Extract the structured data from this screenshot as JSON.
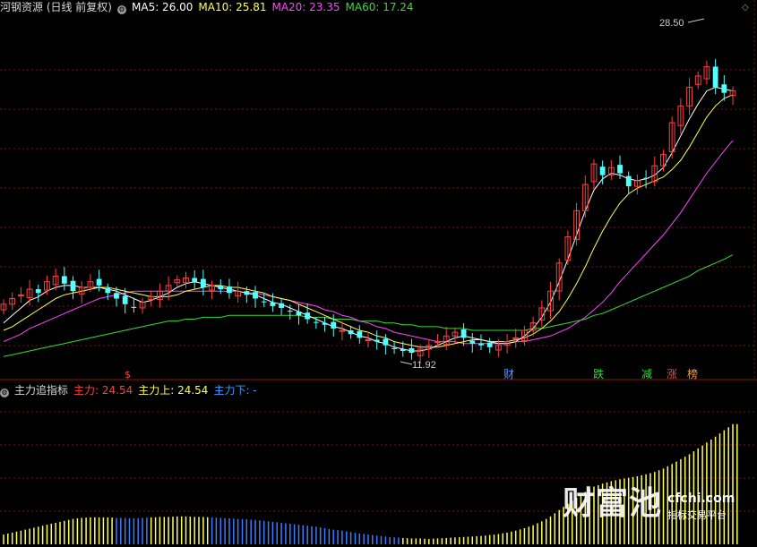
{
  "header": {
    "stock_title": "河钢资源 (日线 前复权)",
    "ma5_label": "MA5: 26.00",
    "ma10_label": "MA10: 25.81",
    "ma20_label": "MA20: 23.35",
    "ma60_label": "MA60: 17.24"
  },
  "indicator": {
    "title": "主力追指标",
    "main_label": "主力: 24.54",
    "upper_label": "主力上: 24.54",
    "lower_label": "主力下: -"
  },
  "annotations": {
    "high_price": "28.50",
    "low_price": "11.92",
    "markers": [
      "$",
      "财",
      "跌",
      "减",
      "涨",
      "榜"
    ]
  },
  "watermark": {
    "cn": "财富池",
    "en": "cfchi.com",
    "sub": "指标交易平台"
  },
  "colors": {
    "background": "#000000",
    "grid": "#7a1010",
    "up_candle": "#ff4040",
    "down_candle": "#54ffff",
    "ma5": "#ffffff",
    "ma10": "#ffff4d",
    "ma20": "#ff44ff",
    "ma60": "#33dd33",
    "bar_yellow": "#ffff55",
    "bar_blue": "#3a7dff"
  },
  "chart_data": {
    "type": "candlestick",
    "price_range": [
      11,
      30
    ],
    "high": 28.5,
    "low": 11.92,
    "closes": [
      14.6,
      14.9,
      15.1,
      15.4,
      15.2,
      15.8,
      16.1,
      15.7,
      15.3,
      15.5,
      15.8,
      15.6,
      15.2,
      14.9,
      14.6,
      14.4,
      14.7,
      15.0,
      15.3,
      15.6,
      15.9,
      16.0,
      15.8,
      15.5,
      15.6,
      15.4,
      15.2,
      15.3,
      15.1,
      14.9,
      14.7,
      14.5,
      14.4,
      14.2,
      14.0,
      13.8,
      13.6,
      13.5,
      13.3,
      13.2,
      13.0,
      12.8,
      12.7,
      12.6,
      12.4,
      12.2,
      12.1,
      12.0,
      12.2,
      12.4,
      12.6,
      12.9,
      13.1,
      12.8,
      12.5,
      12.4,
      12.3,
      12.4,
      12.6,
      12.8,
      13.2,
      13.6,
      14.4,
      15.3,
      16.8,
      18.2,
      19.6,
      21.0,
      22.1,
      21.5,
      21.9,
      21.6,
      20.9,
      21.2,
      21.3,
      22.0,
      22.6,
      24.3,
      25.2,
      26.2,
      26.8,
      27.3,
      26.2,
      25.9,
      26.0
    ],
    "ma5": [
      13.6,
      14.0,
      14.4,
      14.8,
      15.0,
      15.3,
      15.5,
      15.6,
      15.6,
      15.5,
      15.5,
      15.5,
      15.4,
      15.3,
      15.1,
      14.9,
      14.7,
      14.8,
      15.0,
      15.2,
      15.5,
      15.7,
      15.8,
      15.7,
      15.6,
      15.5,
      15.4,
      15.3,
      15.2,
      15.1,
      14.9,
      14.7,
      14.6,
      14.4,
      14.2,
      14.0,
      13.8,
      13.6,
      13.4,
      13.3,
      13.1,
      12.9,
      12.8,
      12.6,
      12.5,
      12.3,
      12.2,
      12.1,
      12.1,
      12.2,
      12.4,
      12.6,
      12.8,
      12.9,
      12.8,
      12.7,
      12.6,
      12.5,
      12.5,
      12.6,
      12.9,
      13.3,
      13.9,
      14.7,
      15.8,
      17.0,
      18.3,
      19.6,
      20.7,
      21.3,
      21.6,
      21.5,
      21.3,
      21.2,
      21.3,
      21.5,
      21.9,
      22.7,
      23.6,
      24.5,
      25.3,
      26.0,
      26.2,
      26.1,
      26.0
    ],
    "ma10": [
      13.2,
      13.4,
      13.7,
      14.0,
      14.3,
      14.6,
      14.9,
      15.1,
      15.2,
      15.3,
      15.4,
      15.5,
      15.5,
      15.4,
      15.3,
      15.2,
      15.1,
      15.0,
      15.0,
      15.0,
      15.1,
      15.3,
      15.4,
      15.5,
      15.6,
      15.6,
      15.5,
      15.5,
      15.4,
      15.3,
      15.2,
      15.0,
      14.9,
      14.8,
      14.6,
      14.4,
      14.2,
      14.0,
      13.8,
      13.6,
      13.4,
      13.2,
      13.1,
      12.9,
      12.8,
      12.6,
      12.5,
      12.4,
      12.3,
      12.3,
      12.3,
      12.4,
      12.5,
      12.6,
      12.7,
      12.7,
      12.6,
      12.6,
      12.6,
      12.7,
      12.8,
      13.0,
      13.3,
      13.7,
      14.2,
      14.9,
      15.7,
      16.6,
      17.6,
      18.5,
      19.3,
      20.0,
      20.5,
      20.8,
      21.0,
      21.2,
      21.4,
      21.8,
      22.3,
      23.0,
      23.8,
      24.6,
      25.2,
      25.6,
      25.8
    ],
    "ma20": [
      12.6,
      12.8,
      13.0,
      13.3,
      13.5,
      13.7,
      13.9,
      14.1,
      14.3,
      14.5,
      14.7,
      14.9,
      15.0,
      15.1,
      15.2,
      15.3,
      15.3,
      15.3,
      15.3,
      15.3,
      15.3,
      15.3,
      15.3,
      15.3,
      15.3,
      15.3,
      15.3,
      15.3,
      15.2,
      15.2,
      15.1,
      15.0,
      14.9,
      14.8,
      14.7,
      14.6,
      14.5,
      14.3,
      14.2,
      14.0,
      13.9,
      13.7,
      13.6,
      13.4,
      13.3,
      13.1,
      13.0,
      12.9,
      12.8,
      12.7,
      12.6,
      12.6,
      12.6,
      12.5,
      12.5,
      12.5,
      12.5,
      12.5,
      12.5,
      12.6,
      12.6,
      12.7,
      12.8,
      12.9,
      13.1,
      13.3,
      13.6,
      13.9,
      14.3,
      14.7,
      15.2,
      15.8,
      16.3,
      16.8,
      17.3,
      17.8,
      18.3,
      18.9,
      19.5,
      20.2,
      20.9,
      21.6,
      22.2,
      22.8,
      23.35
    ],
    "ma60": [
      11.8,
      11.9,
      12.0,
      12.1,
      12.2,
      12.3,
      12.4,
      12.5,
      12.6,
      12.7,
      12.8,
      12.9,
      13.0,
      13.1,
      13.2,
      13.3,
      13.4,
      13.5,
      13.6,
      13.7,
      13.7,
      13.8,
      13.8,
      13.9,
      13.9,
      13.9,
      14.0,
      14.0,
      14.0,
      14.0,
      14.0,
      14.0,
      14.0,
      14.0,
      14.0,
      13.9,
      13.9,
      13.9,
      13.8,
      13.8,
      13.8,
      13.7,
      13.7,
      13.7,
      13.6,
      13.6,
      13.5,
      13.5,
      13.4,
      13.4,
      13.4,
      13.3,
      13.3,
      13.3,
      13.2,
      13.2,
      13.2,
      13.2,
      13.2,
      13.2,
      13.2,
      13.3,
      13.3,
      13.4,
      13.5,
      13.6,
      13.7,
      13.8,
      14.0,
      14.1,
      14.3,
      14.5,
      14.7,
      14.9,
      15.1,
      15.3,
      15.5,
      15.7,
      15.9,
      16.1,
      16.4,
      16.6,
      16.8,
      17.0,
      17.24
    ],
    "indicator_range": [
      0,
      30
    ],
    "indicator_values": [
      2.0,
      2.4,
      2.8,
      3.2,
      3.6,
      4.0,
      4.4,
      4.8,
      5.2,
      5.4,
      5.5,
      5.5,
      5.5,
      5.4,
      5.4,
      5.3,
      5.4,
      5.5,
      5.6,
      5.6,
      5.7,
      5.7,
      5.6,
      5.6,
      5.5,
      5.4,
      5.3,
      5.2,
      5.1,
      5.0,
      4.8,
      4.6,
      4.4,
      4.2,
      4.0,
      3.8,
      3.6,
      3.3,
      3.0,
      2.8,
      2.5,
      2.2,
      2.0,
      1.8,
      1.6,
      1.4,
      1.3,
      1.2,
      1.2,
      1.1,
      1.2,
      1.3,
      1.4,
      1.5,
      1.6,
      1.7,
      1.9,
      2.1,
      2.4,
      2.8,
      3.3,
      3.9,
      4.7,
      5.7,
      7.0,
      8.3,
      9.5,
      10.7,
      11.8,
      12.4,
      12.9,
      13.3,
      13.6,
      13.9,
      14.3,
      14.8,
      15.5,
      16.4,
      17.4,
      18.4,
      19.6,
      20.8,
      22.0,
      23.3,
      24.54
    ],
    "indicator_colors": [
      "y",
      "y",
      "y",
      "y",
      "y",
      "y",
      "y",
      "y",
      "y",
      "y",
      "y",
      "y",
      "y",
      "b",
      "b",
      "b",
      "b",
      "y",
      "y",
      "y",
      "y",
      "y",
      "y",
      "y",
      "b",
      "b",
      "b",
      "b",
      "b",
      "b",
      "b",
      "b",
      "b",
      "b",
      "b",
      "b",
      "b",
      "b",
      "b",
      "b",
      "b",
      "b",
      "b",
      "b",
      "b",
      "b",
      "y",
      "y",
      "y",
      "y",
      "y",
      "y",
      "y",
      "y",
      "y",
      "y",
      "y",
      "y",
      "y",
      "y",
      "y",
      "y",
      "y",
      "y",
      "y",
      "y",
      "y",
      "y",
      "y",
      "y",
      "y",
      "y",
      "y",
      "y",
      "y",
      "y",
      "y",
      "y",
      "y",
      "y",
      "y",
      "y",
      "y",
      "y",
      "y"
    ]
  }
}
